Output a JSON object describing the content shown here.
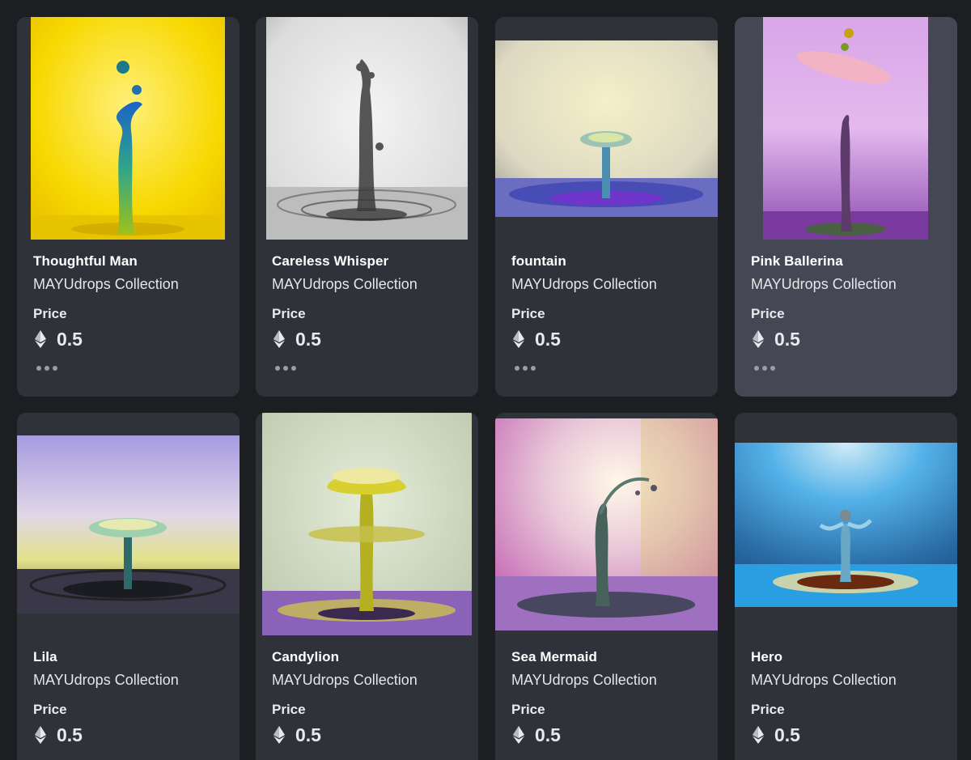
{
  "currency": {
    "icon": "ethereum-icon"
  },
  "more_icon": "more-horizontal-icon",
  "cards": [
    {
      "title": "Thoughtful Man",
      "collection": "MAYUdrops Collection",
      "price_label": "Price",
      "price": "0.5",
      "image": "water-drop-sculpture-yellow"
    },
    {
      "title": "Careless Whisper",
      "collection": "MAYUdrops Collection",
      "price_label": "Price",
      "price": "0.5",
      "image": "water-drop-sculpture-monochrome"
    },
    {
      "title": "fountain",
      "collection": "MAYUdrops Collection",
      "price_label": "Price",
      "price": "0.5",
      "image": "water-drop-sculpture-fountain"
    },
    {
      "title": "Pink Ballerina",
      "collection": "MAYUdrops Collection",
      "price_label": "Price",
      "price": "0.5",
      "image": "water-drop-sculpture-pink"
    },
    {
      "title": "Lila",
      "collection": "MAYUdrops Collection",
      "price_label": "Price",
      "price": "0.5",
      "image": "water-drop-sculpture-lila"
    },
    {
      "title": "Candylion",
      "collection": "MAYUdrops Collection",
      "price_label": "Price",
      "price": "0.5",
      "image": "water-drop-sculpture-candylion"
    },
    {
      "title": "Sea Mermaid",
      "collection": "MAYUdrops Collection",
      "price_label": "Price",
      "price": "0.5",
      "image": "water-drop-sculpture-mermaid"
    },
    {
      "title": "Hero",
      "collection": "MAYUdrops Collection",
      "price_label": "Price",
      "price": "0.5",
      "image": "water-drop-sculpture-hero"
    }
  ],
  "colors": {
    "background": "#1d1e22",
    "card": "#30323a",
    "card_hover": "#454854",
    "text": "#ffffff"
  }
}
